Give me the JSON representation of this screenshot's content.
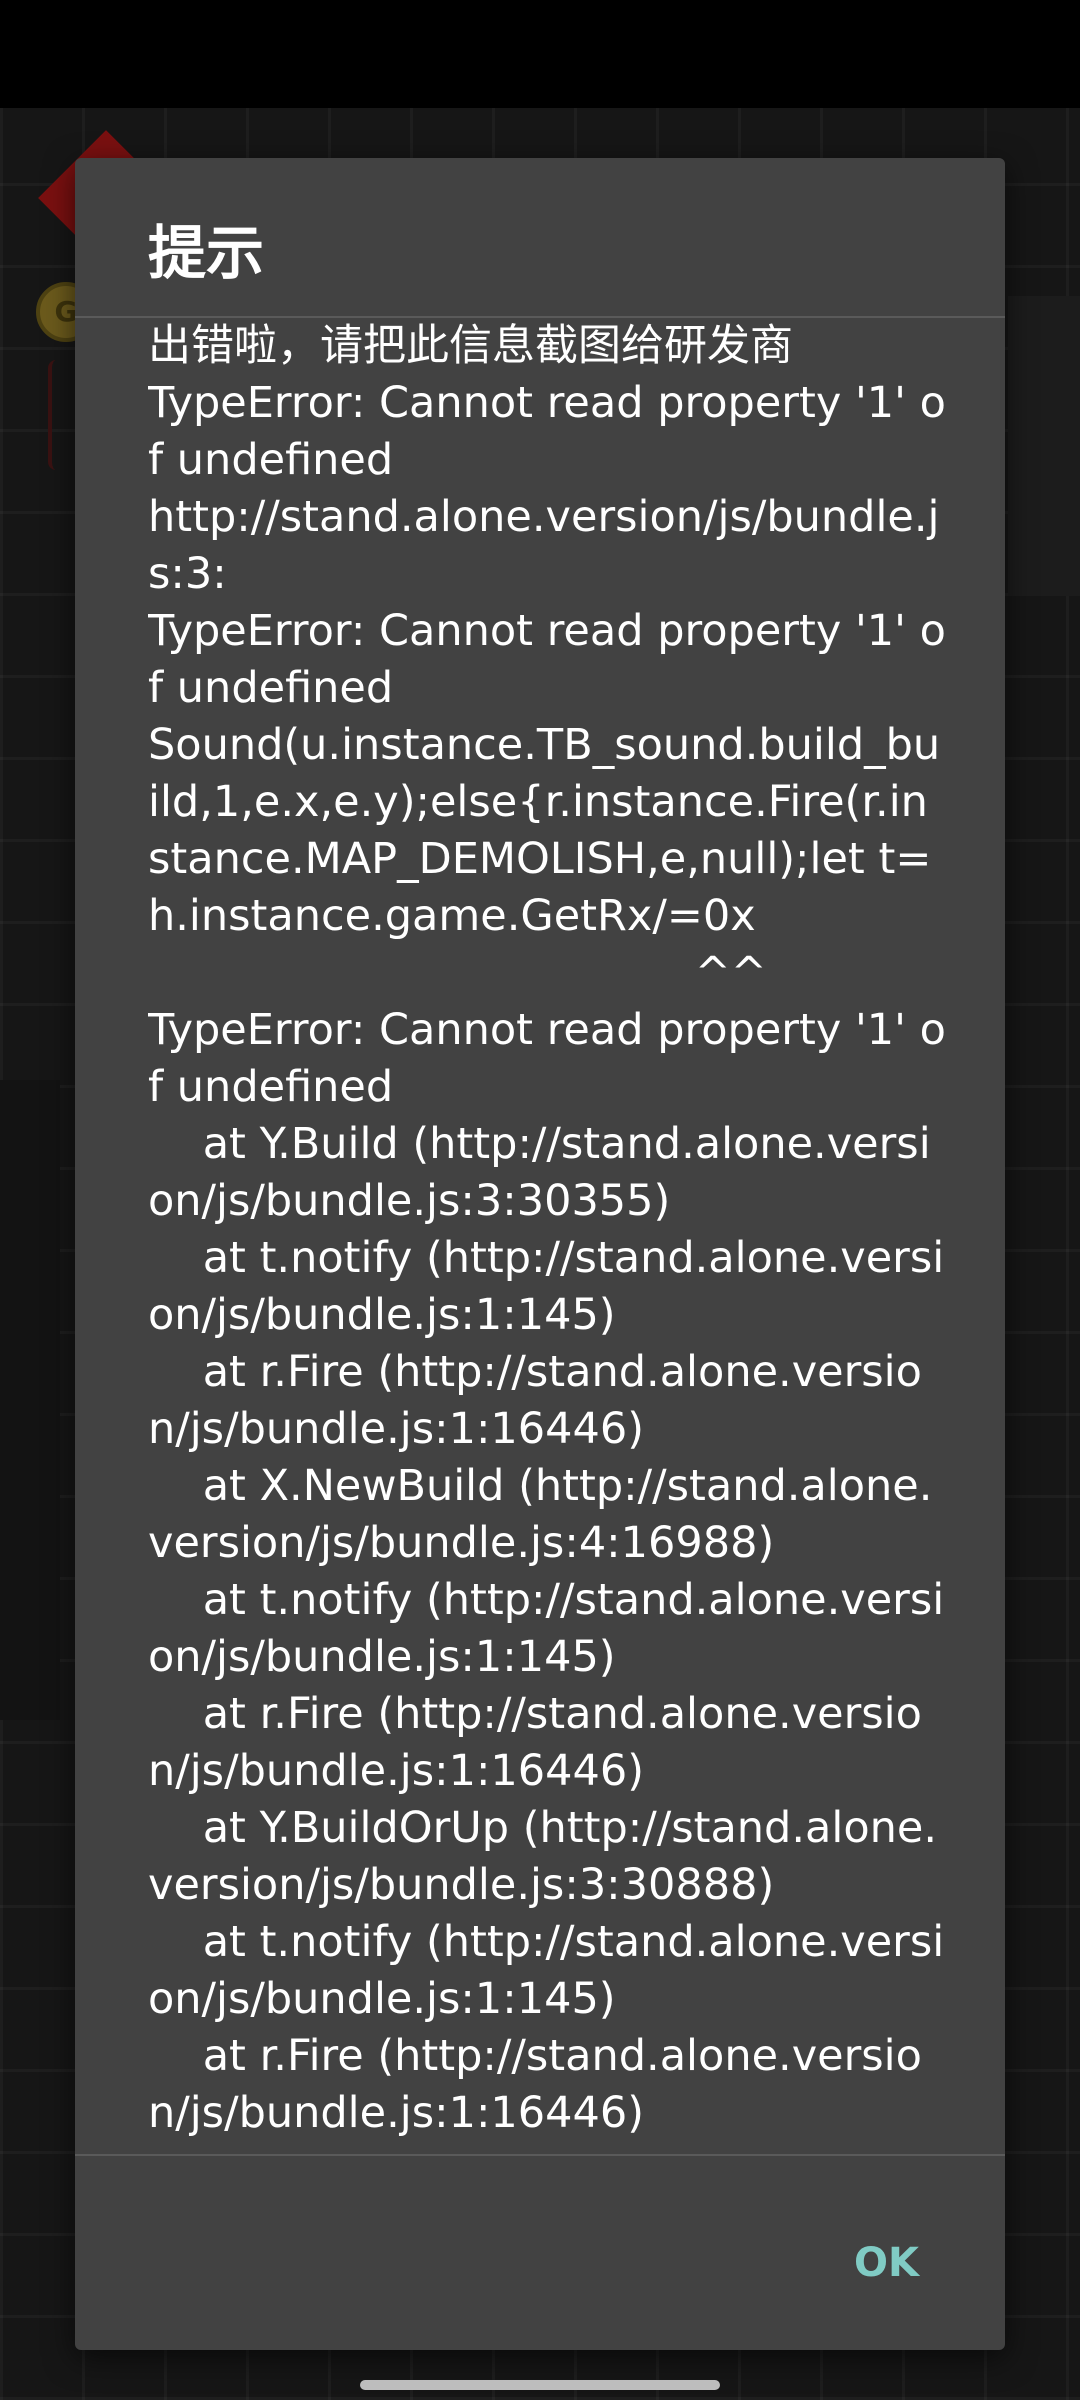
{
  "dialog": {
    "title": "提示",
    "message": "出错啦，请把此信息截图给研发商\nTypeError: Cannot read property '1' of undefined\nhttp://stand.alone.version/js/bundle.js:3:\nTypeError: Cannot read property '1' of undefined\nSound(u.instance.TB_sound.build_build,1,e.x,e.y);else{r.instance.Fire(r.instance.MAP_DEMOLISH,e,null);let t=h.instance.game.GetRx/=0x\n                                        ^^\nTypeError: Cannot read property '1' of undefined\n    at Y.Build (http://stand.alone.version/js/bundle.js:3:30355)\n    at t.notify (http://stand.alone.version/js/bundle.js:1:145)\n    at r.Fire (http://stand.alone.version/js/bundle.js:1:16446)\n    at X.NewBuild (http://stand.alone.version/js/bundle.js:4:16988)\n    at t.notify (http://stand.alone.version/js/bundle.js:1:145)\n    at r.Fire (http://stand.alone.version/js/bundle.js:1:16446)\n    at Y.BuildOrUp (http://stand.alone.version/js/bundle.js:3:30888)\n    at t.notify (http://stand.alone.version/js/bundle.js:1:145)\n    at r.Fire (http://stand.alone.version/js/bundle.js:1:16446)",
    "ok_label": "OK"
  },
  "background": {
    "coin_glyph": "G"
  },
  "colors": {
    "dialog_background": "#424242",
    "accent": "#80cbc4",
    "text": "#ffffff"
  }
}
